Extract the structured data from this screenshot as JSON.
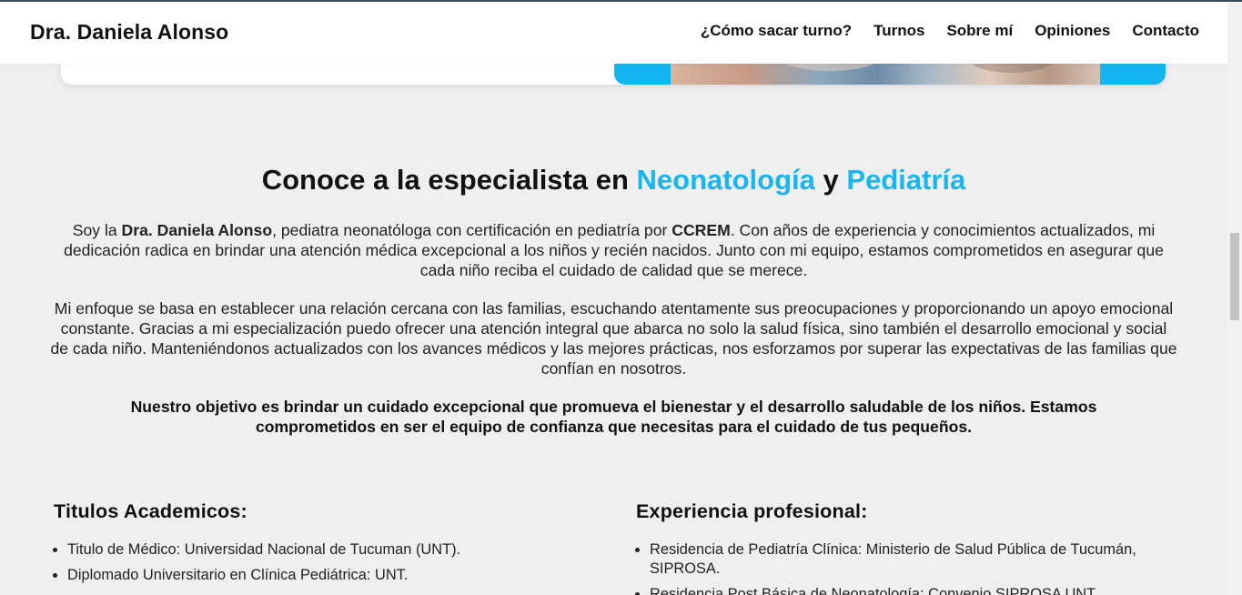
{
  "navbar": {
    "brand": "Dra. Daniela Alonso",
    "links": [
      "¿Cómo sacar turno?",
      "Turnos",
      "Sobre mí",
      "Opiniones",
      "Contacto"
    ]
  },
  "about": {
    "title_prefix": "Conoce a la especialista en ",
    "title_accent1": "Neonatología",
    "title_mid": " y ",
    "title_accent2": "Pediatría",
    "p1_a": "Soy la ",
    "p1_name": "Dra. Daniela Alonso",
    "p1_b": ", pediatra neonatóloga con certificación en pediatría por ",
    "p1_cert": "CCREM",
    "p1_c": ". Con años de experiencia y conocimientos actualizados, mi dedicación radica en brindar una atención médica excepcional a los niños y recién nacidos. Junto con mi equipo, estamos comprometidos en asegurar que cada niño reciba el cuidado de calidad que se merece.",
    "p2": "Mi enfoque se basa en establecer una relación cercana con las familias, escuchando atentamente sus preocupaciones y proporcionando un apoyo emocional constante. Gracias a mi especialización puedo ofrecer una atención integral que abarca no solo la salud física, sino también el desarrollo emocional y social de cada niño. Manteniéndonos actualizados con los avances médicos y las mejores prácticas, nos esforzamos por superar las expectativas de las familias que confían en nosotros.",
    "p3": "Nuestro objetivo es brindar un cuidado excepcional que promueva el bienestar y el desarrollo saludable de los niños. Estamos comprometidos en ser el equipo de confianza que necesitas para el cuidado de tus pequeños."
  },
  "academics": {
    "title": "Titulos Academicos:",
    "items": [
      "Titulo de Médico: Universidad Nacional de Tucuman (UNT).",
      "Diplomado Universitario en Clínica Pediátrica: UNT."
    ]
  },
  "experience": {
    "title": "Experiencia profesional:",
    "items": [
      "Residencia de Pediatría Clínica: Ministerio de Salud Pública de Tucumán, SIPROSA.",
      "Residencia Post Básica de Neonatología: Convenio SIPROSA UNT."
    ]
  },
  "colors": {
    "accent": "#17b6f0",
    "hero_blue": "#12b5ef",
    "background": "#efeff0"
  },
  "icons": [
    "hero-photo"
  ]
}
